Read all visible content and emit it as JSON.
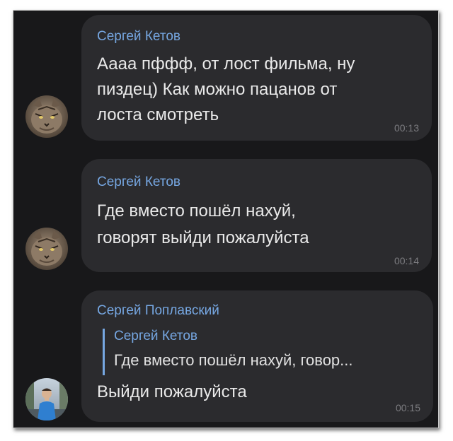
{
  "messages": [
    {
      "sender": "Сергей Кетов",
      "lines": [
        "Аааа пффф, от лост фильма, ну",
        "пиздец) Как можно пацанов от",
        "лоста смотреть"
      ],
      "time": "00:13",
      "avatar_icon": "cat-avatar-icon"
    },
    {
      "sender": "Сергей Кетов",
      "lines": [
        "Где вместо пошёл нахуй,",
        "говорят выйди пожалуйста"
      ],
      "time": "00:14",
      "avatar_icon": "cat-avatar-icon"
    },
    {
      "sender": "Сергей Поплавский",
      "reply": {
        "sender": "Сергей Кетов",
        "text": "Где вместо пошёл нахуй, говор..."
      },
      "lines": [
        "Выйди пожалуйста"
      ],
      "time": "00:15",
      "avatar_icon": "person-photo-avatar-icon"
    }
  ],
  "colors": {
    "background": "#18181a",
    "bubble": "#2b2b2e",
    "sender_name": "#76a7e2",
    "message_text": "#e9e9e9",
    "timestamp": "#7c7c80"
  }
}
